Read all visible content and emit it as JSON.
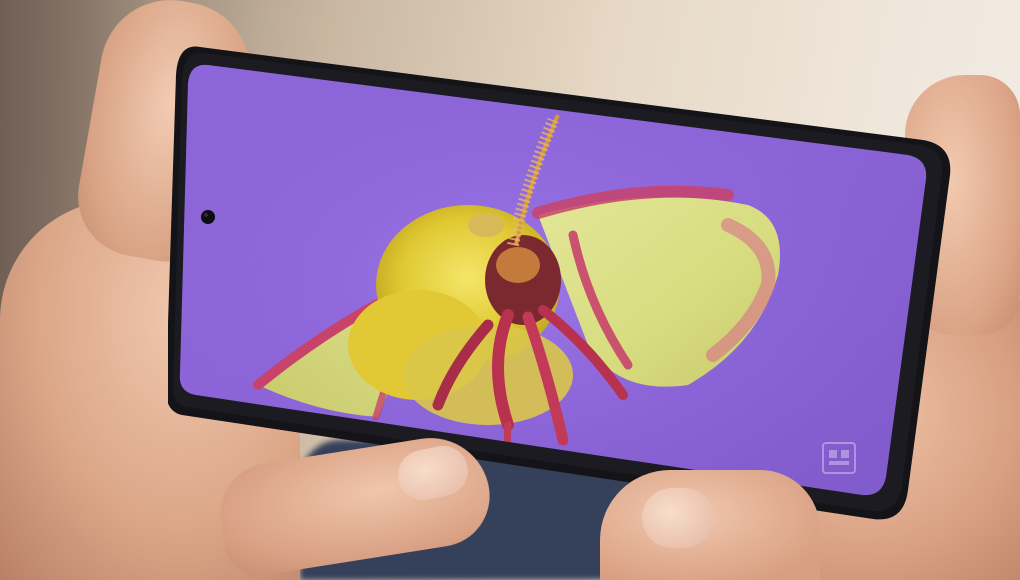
{
  "scene": {
    "subject": "moth-on-phone-screen",
    "colors": {
      "screen_background": "#8a63d6",
      "screen_glow": "#a27ff0",
      "phone_frame": "#141318",
      "moth_body": "#e8d23a",
      "moth_wing": "#d9e08a",
      "moth_wing_edge": "#c8426a",
      "moth_legs": "#b8324f",
      "skin": "#e2ae92"
    }
  },
  "icons": {
    "front_camera": "front-camera-icon",
    "watermark": "watermark-logo-icon"
  }
}
